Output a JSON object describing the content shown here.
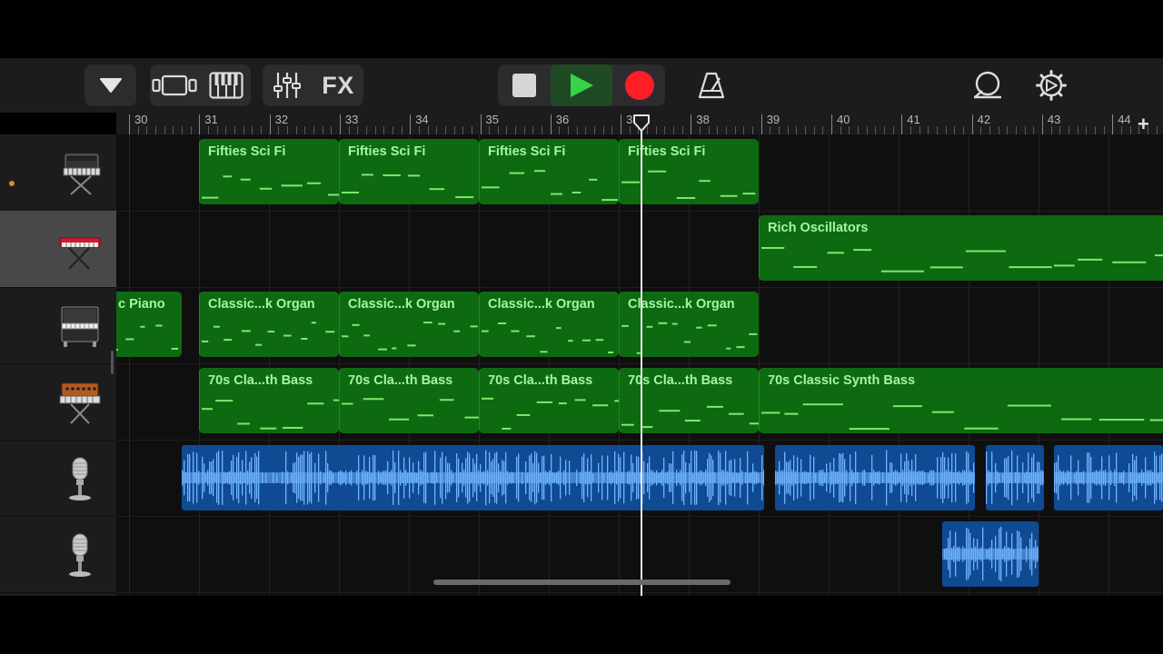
{
  "toolbar": {
    "tracks_menu_icon": "triangle-down-icon",
    "view_icon": "tracks-view-icon",
    "keyboard_icon": "piano-keyboard-icon",
    "mixer_icon": "mixer-sliders-icon",
    "fx_label": "FX",
    "stop_icon": "stop-icon",
    "play_icon": "play-icon",
    "record_icon": "record-icon",
    "metronome_icon": "metronome-icon",
    "loop_icon": "loop-icon",
    "settings_icon": "gear-icon",
    "colors": {
      "play": "#35d44a",
      "record": "#ff1e26",
      "play_bg": "#1f4a23"
    }
  },
  "ruler": {
    "bars": [
      "30",
      "31",
      "32",
      "33",
      "34",
      "35",
      "36",
      "37",
      "38",
      "39",
      "40",
      "41",
      "42",
      "43",
      "44"
    ],
    "add_label": "+"
  },
  "tracks": [
    {
      "instrument": "synth-keyboard-icon",
      "selected": false,
      "has_indicator": true
    },
    {
      "instrument": "red-keyboard-icon",
      "selected": true,
      "has_indicator": false
    },
    {
      "instrument": "upright-piano-icon",
      "selected": false,
      "has_indicator": false
    },
    {
      "instrument": "analog-synth-icon",
      "selected": false,
      "has_indicator": false
    },
    {
      "instrument": "microphone-icon",
      "selected": false,
      "has_indicator": false
    },
    {
      "instrument": "microphone-icon",
      "selected": false,
      "has_indicator": false
    }
  ],
  "regions": {
    "fifties": [
      "Fifties Sci Fi",
      "Fifties Sci Fi",
      "Fifties Sci Fi",
      "Fifties Sci Fi"
    ],
    "rich": "Rich Oscillators",
    "piano": "c Piano",
    "organ": [
      "Classic...k Organ",
      "Classic...k Organ",
      "Classic...k Organ",
      "Classic...k Organ"
    ],
    "bass": [
      "70s Cla...th Bass",
      "70s Cla...th Bass",
      "70s Cla...th Bass",
      "70s Cla...th Bass"
    ],
    "bass_long": "70s Classic Synth Bass"
  },
  "colors": {
    "midi_region": "#0d6a10",
    "midi_note": "#7fe86f",
    "audio_region": "#0f4a92",
    "audio_wave": "#6fb3ff"
  }
}
